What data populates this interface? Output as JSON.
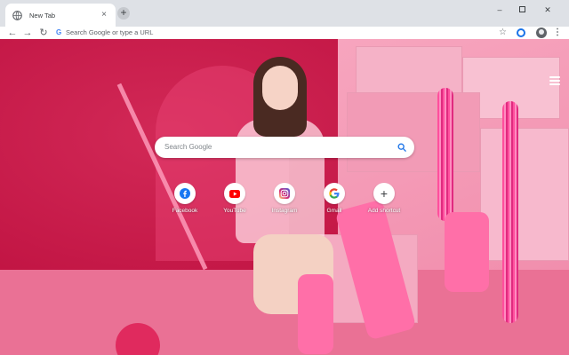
{
  "browser": {
    "tab": {
      "title": "New Tab",
      "close_glyph": "×",
      "icon": "globe-icon"
    },
    "new_tab_glyph": "+",
    "window_controls": {
      "minimize": "–",
      "close": "✕"
    },
    "toolbar": {
      "back_glyph": "←",
      "forward_glyph": "→",
      "reload_glyph": "↻",
      "omnibox_placeholder": "Search Google or type a URL",
      "omnibox_logo": "G",
      "bookmark_star": "☆",
      "menu_glyph": "⋮"
    }
  },
  "new_tab_page": {
    "search_placeholder": "Search Google",
    "shortcuts": [
      {
        "label": "Facebook",
        "icon": "facebook-icon"
      },
      {
        "label": "YouTube",
        "icon": "youtube-icon"
      },
      {
        "label": "Instagram",
        "icon": "instagram-icon"
      },
      {
        "label": "Gmail",
        "icon": "google-icon"
      },
      {
        "label": "Add shortcut",
        "icon": "plus-icon",
        "glyph": "+"
      }
    ]
  },
  "colors": {
    "accent": "#1a73e8",
    "background_primary": "#c71c4b",
    "background_boxes": "#f49ab6"
  }
}
